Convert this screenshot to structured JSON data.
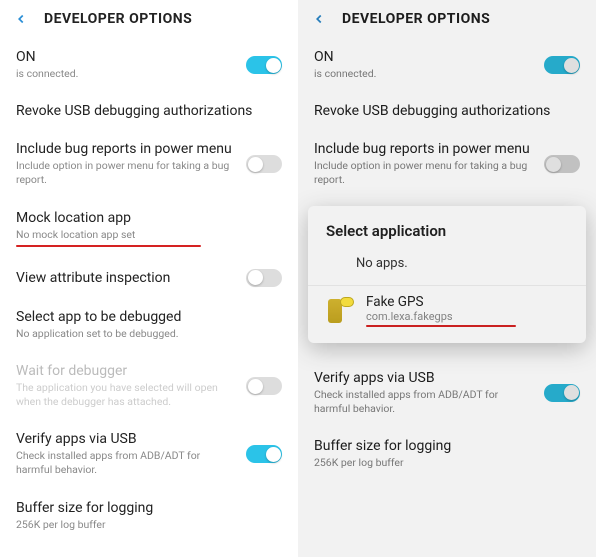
{
  "colors": {
    "accent": "#2bc3e8",
    "highlight": "#d52222"
  },
  "left": {
    "title": "DEVELOPER OPTIONS",
    "on_label": "ON",
    "on_sub": "is connected.",
    "revoke": "Revoke USB debugging authorizations",
    "bug_title": "Include bug reports in power menu",
    "bug_sub": "Include option in power menu for taking a bug report.",
    "mock_title": "Mock location app",
    "mock_sub": "No mock location app set",
    "view_attr": "View attribute inspection",
    "select_app": "Select app to be debugged",
    "select_app_sub": "No application set to be debugged.",
    "wait_dbg": "Wait for debugger",
    "wait_dbg_sub": "The application you have selected will open when the debugger has attached.",
    "verify": "Verify apps via USB",
    "verify_sub": "Check installed apps from ADB/ADT for harmful behavior.",
    "buffer": "Buffer size for logging",
    "buffer_sub": "256K per log buffer"
  },
  "right": {
    "title": "DEVELOPER OPTIONS",
    "on_label": "ON",
    "on_sub": "is connected.",
    "revoke": "Revoke USB debugging authorizations",
    "bug_title": "Include bug reports in power menu",
    "bug_sub": "Include option in power menu for taking a bug report.",
    "verify": "Verify apps via USB",
    "verify_sub": "Check installed apps from ADB/ADT for harmful behavior.",
    "buffer": "Buffer size for logging",
    "buffer_sub": "256K per log buffer",
    "dialog": {
      "title": "Select application",
      "noapps": "No apps.",
      "app_name": "Fake GPS",
      "app_pkg": "com.lexa.fakegps"
    }
  }
}
